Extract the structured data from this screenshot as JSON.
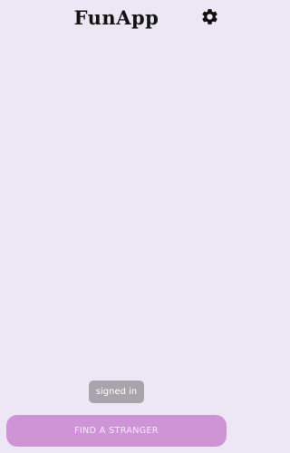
{
  "header": {
    "title": "FunApp",
    "settings_icon": "gear-icon"
  },
  "toast": {
    "text": "signed in"
  },
  "actions": {
    "find_label": "FIND A STRANGER"
  },
  "colors": {
    "background": "#ede6f4",
    "primary_button": "#cf94d6",
    "primary_button_text": "#f6ecf8",
    "toast_bg": "#a8a4ab",
    "title_text": "#141414"
  }
}
